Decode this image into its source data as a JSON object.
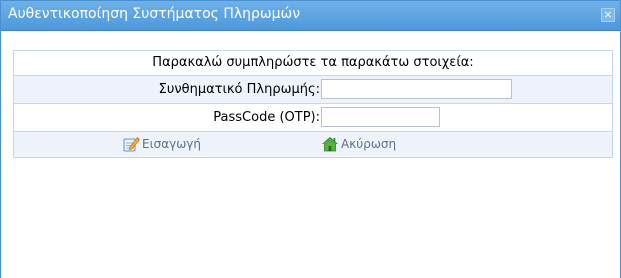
{
  "dialog": {
    "title": "Αυθεντικοποίηση Συστήματος Πληρωμών",
    "close_glyph": "×"
  },
  "form": {
    "intro": "Παρακαλώ συμπληρώστε τα παρακάτω στοιχεία:",
    "payment_code": {
      "label": "Συνθηματικό Πληρωμής:",
      "value": "",
      "placeholder": ""
    },
    "passcode": {
      "label": "PassCode (OTP):",
      "value": "",
      "placeholder": ""
    }
  },
  "actions": {
    "insert": {
      "label": "Εισαγωγή",
      "icon": "edit-document-icon"
    },
    "cancel": {
      "label": "Ακύρωση",
      "icon": "home-icon"
    }
  },
  "colors": {
    "titlebar": "#4d98dc",
    "row_alt": "#eef3fb",
    "action_text": "#5c7186"
  }
}
